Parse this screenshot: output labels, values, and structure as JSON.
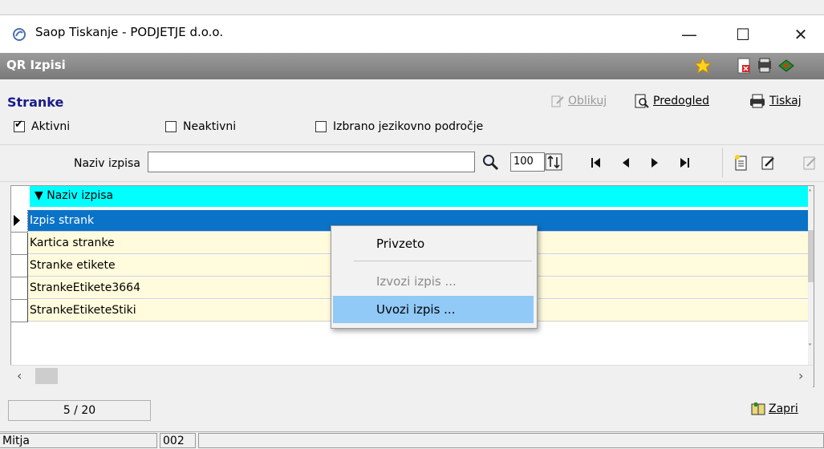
{
  "window": {
    "title": "Saop Tiskanje - PODJETJE d.o.o.",
    "minimize": "—",
    "maximize": "☐",
    "close": "✕"
  },
  "header": {
    "title": "QR Izpisi"
  },
  "section": {
    "title": "Stranke",
    "oblikuj_label": "Oblikuj",
    "predogled_label": "Predogled",
    "tiskaj_label": "Tiskaj"
  },
  "filters": {
    "aktivni": {
      "label": "Aktivni",
      "checked": true
    },
    "neaktivni": {
      "label": "Neaktivni",
      "checked": false
    },
    "jezik": {
      "label": "Izbrano jezikovno področje",
      "checked": false
    }
  },
  "search": {
    "label": "Naziv izpisa",
    "value": "",
    "zoom": "100"
  },
  "grid": {
    "column_header": "▼ Naziv izpisa",
    "rows": [
      "Izpis strank",
      "Kartica stranke",
      "Stranke etikete",
      "StrankeEtikete3664",
      "StrankeEtiketeStiki"
    ],
    "selected_index": 0
  },
  "context_menu": {
    "items": [
      {
        "label": "Privzeto",
        "disabled": false
      },
      {
        "label": "Izvozi izpis ...",
        "disabled": true
      },
      {
        "label": "Uvozi izpis ...",
        "disabled": false
      }
    ]
  },
  "footer": {
    "counter": "5 / 20",
    "close_label": "Zapri",
    "user": "Mitja",
    "code": "002"
  },
  "colors": {
    "header_bg": "#00ffff",
    "selected_row": "#0a73c8",
    "row_bg": "#fffbdc",
    "menu_hover": "#91c9f7"
  }
}
